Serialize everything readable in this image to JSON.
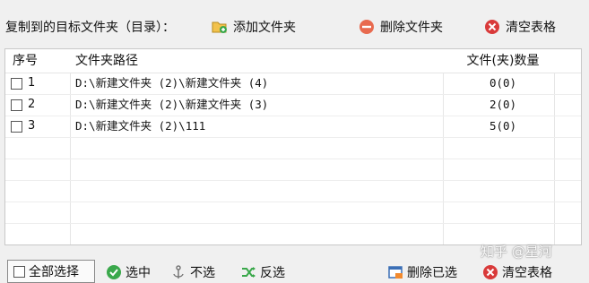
{
  "toolbar": {
    "title": "复制到的目标文件夹（目录）：",
    "add_folder": "添加文件夹",
    "delete_folder": "删除文件夹",
    "clear_table": "清空表格"
  },
  "table": {
    "headers": {
      "seq": "序号",
      "path": "文件夹路径",
      "count": "文件(夹)数量"
    },
    "rows": [
      {
        "seq": "1",
        "path": "D:\\新建文件夹 (2)\\新建文件夹 (4)",
        "count": "0(0)"
      },
      {
        "seq": "2",
        "path": "D:\\新建文件夹 (2)\\新建文件夹 (3)",
        "count": "2(0)"
      },
      {
        "seq": "3",
        "path": "D:\\新建文件夹 (2)\\111",
        "count": "5(0)"
      }
    ]
  },
  "bottom": {
    "select_all": "全部选择",
    "select": "选中",
    "unselect": "不选",
    "invert": "反选",
    "delete_selected": "删除已选",
    "clear_table": "清空表格"
  },
  "watermark": "知乎 @星河",
  "colors": {
    "add_icon": "#e8b33c",
    "delete_icon": "#e04b3f",
    "clear_icon": "#d93a3a",
    "select_icon": "#3aa84b"
  }
}
